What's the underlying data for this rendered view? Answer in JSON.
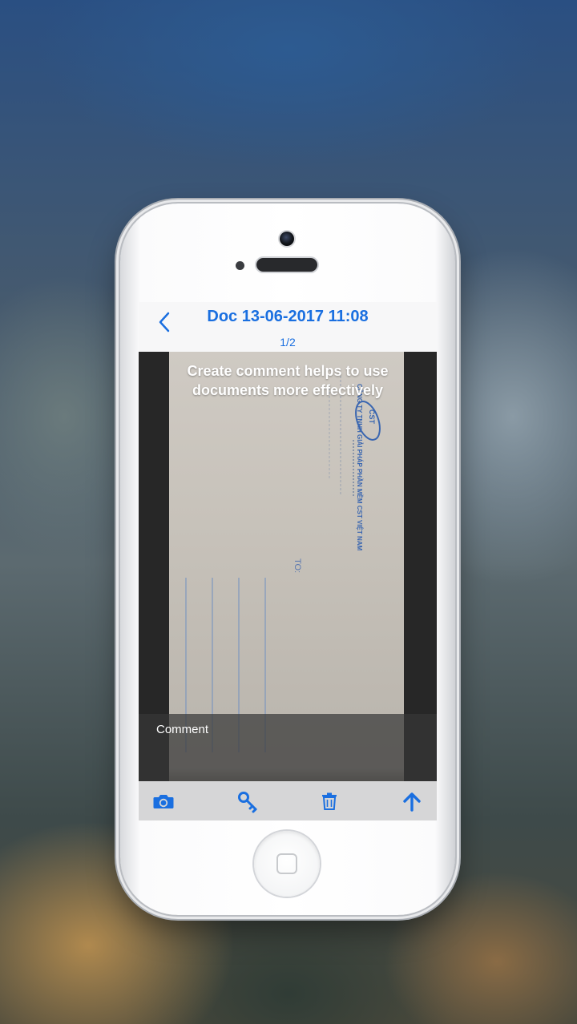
{
  "app": {
    "title": "Doc 13-06-2017 11:08",
    "page_indicator": "1/2"
  },
  "document": {
    "hint": "Create comment helps to use documents more effectively",
    "logo_text": "CST",
    "company_line_1": "CÔNG TY TNHH GIẢI PHÁP PHẦN MỀM CST VIỆT NAM",
    "to_label": "TO:"
  },
  "comment": {
    "placeholder": "Comment"
  },
  "toolbar": {
    "items": [
      {
        "name": "camera-icon"
      },
      {
        "name": "key-icon"
      },
      {
        "name": "trash-icon"
      },
      {
        "name": "upload-arrow-icon"
      }
    ]
  },
  "colors": {
    "accent": "#1a6fe0",
    "toolbar_bg": "#d6d6d7",
    "navbar_bg": "#f7f7f8",
    "doc_bg": "#272727"
  }
}
